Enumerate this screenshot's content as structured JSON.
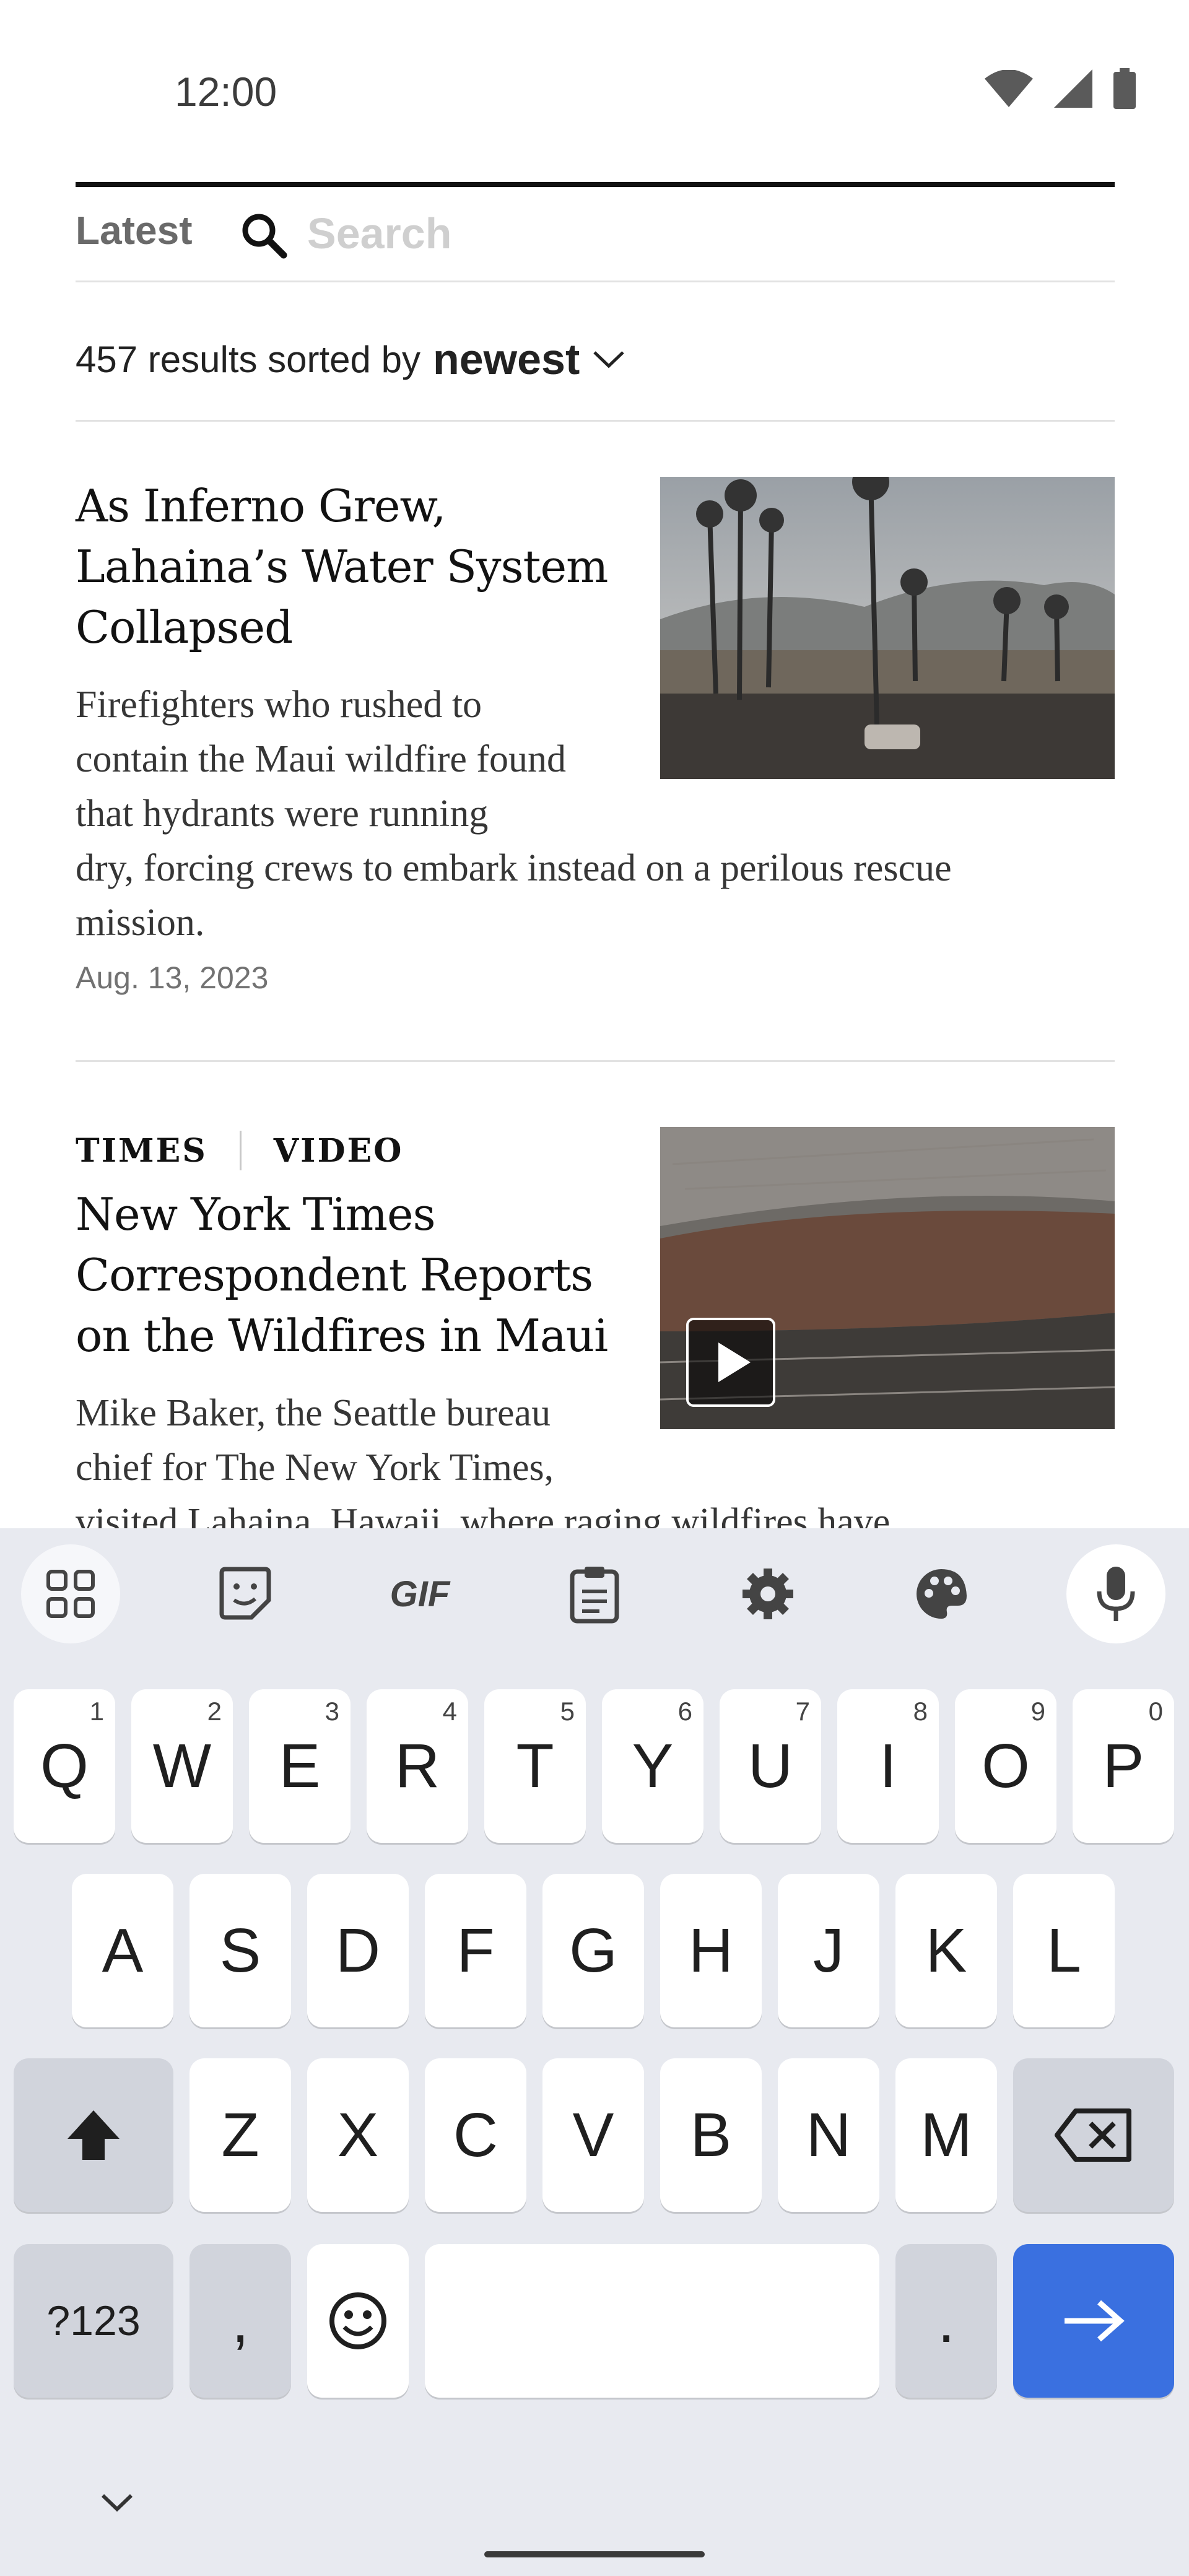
{
  "status_bar": {
    "time": "12:00",
    "icons": [
      "wifi-icon",
      "signal-icon",
      "battery-icon"
    ]
  },
  "search": {
    "tab_label": "Latest",
    "placeholder": "Search",
    "value": ""
  },
  "results": {
    "text": "457 results sorted by",
    "sort_value": "newest"
  },
  "articles": [
    {
      "headline_lines": [
        "As Inferno Grew,",
        "Lahaina’s Water System",
        "Collapsed"
      ],
      "summary_lines": [
        "Firefighters who rushed to",
        "contain the Maui wildfire found",
        "that hydrants were running",
        "dry, forcing crews to embark instead on a perilous rescue",
        "mission."
      ],
      "date": "Aug. 13, 2023"
    },
    {
      "kicker_left": "TIMES",
      "kicker_right": "VIDEO",
      "headline_lines": [
        "New York Times",
        "Correspondent Reports",
        "on the Wildfires in Maui"
      ],
      "summary_lines": [
        "Mike Baker, the Seattle bureau",
        "chief for The New York Times,",
        "visited Lahaina, Hawaii, where raging wildfires have"
      ]
    }
  ],
  "keyboard": {
    "toolbar": [
      "apps-icon",
      "sticker-icon",
      "GIF",
      "clipboard-icon",
      "settings-icon",
      "palette-icon",
      "microphone-icon"
    ],
    "row1": [
      {
        "label": "Q",
        "hint": "1"
      },
      {
        "label": "W",
        "hint": "2"
      },
      {
        "label": "E",
        "hint": "3"
      },
      {
        "label": "R",
        "hint": "4"
      },
      {
        "label": "T",
        "hint": "5"
      },
      {
        "label": "Y",
        "hint": "6"
      },
      {
        "label": "U",
        "hint": "7"
      },
      {
        "label": "I",
        "hint": "8"
      },
      {
        "label": "O",
        "hint": "9"
      },
      {
        "label": "P",
        "hint": "0"
      }
    ],
    "row2": [
      "A",
      "S",
      "D",
      "F",
      "G",
      "H",
      "J",
      "K",
      "L"
    ],
    "row3": [
      "Z",
      "X",
      "C",
      "V",
      "B",
      "N",
      "M"
    ],
    "row4": {
      "symbols": "?123",
      "comma": ",",
      "period": "."
    },
    "colors": {
      "enter": "#3a70e0",
      "background": "#e8eaf0"
    }
  }
}
